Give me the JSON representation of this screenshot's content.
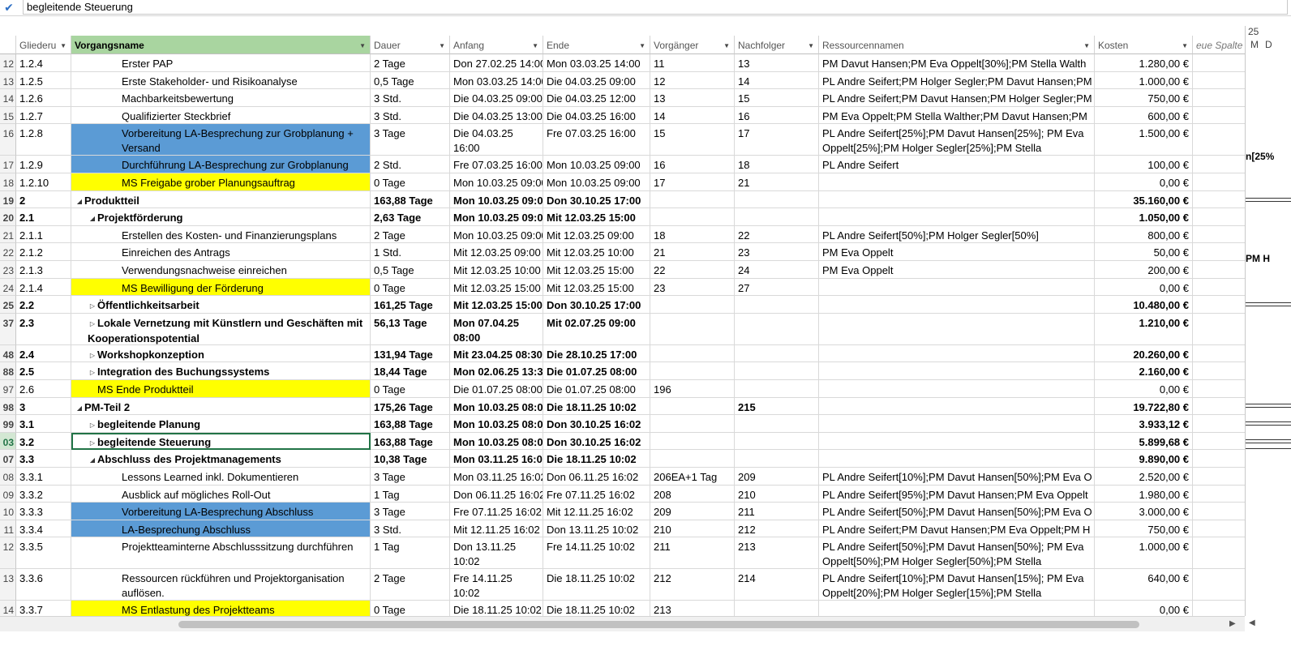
{
  "entry_bar": {
    "value": "begleitende Steuerung"
  },
  "columns": [
    {
      "key": "gliederung",
      "label": "Gliederu"
    },
    {
      "key": "name",
      "label": "Vorgangsname"
    },
    {
      "key": "dauer",
      "label": "Dauer"
    },
    {
      "key": "anfang",
      "label": "Anfang"
    },
    {
      "key": "ende",
      "label": "Ende"
    },
    {
      "key": "vorg",
      "label": "Vorgänger"
    },
    {
      "key": "nachf",
      "label": "Nachfolger"
    },
    {
      "key": "res",
      "label": "Ressourcennamen"
    },
    {
      "key": "kosten",
      "label": "Kosten"
    },
    {
      "key": "neu",
      "label": "eue Spalte h"
    }
  ],
  "gantt": {
    "top_label": "25",
    "day_labels": [
      "M",
      "D"
    ],
    "texts": [
      "n[25%",
      "PM H"
    ]
  },
  "rows": [
    {
      "id": "12",
      "gl": "1.2.4",
      "name": "Erster PAP",
      "level": 3,
      "dauer": "2 Tage",
      "anfang": "Don 27.02.25 14:00",
      "ende": "Mon 03.03.25 14:00",
      "vorg": "11",
      "nachf": "13",
      "res": "PM Davut Hansen;PM Eva Oppelt[30%];PM Stella Walth",
      "kosten": "1.280,00 €"
    },
    {
      "id": "13",
      "gl": "1.2.5",
      "name": "Erste Stakeholder- und Risikoanalyse",
      "level": 3,
      "dauer": "0,5 Tage",
      "anfang": "Mon 03.03.25 14:00",
      "ende": "Die 04.03.25 09:00",
      "vorg": "12",
      "nachf": "14",
      "res": "PL Andre Seifert;PM Holger Segler;PM Davut Hansen;PM",
      "kosten": "1.000,00 €"
    },
    {
      "id": "14",
      "gl": "1.2.6",
      "name": "Machbarkeitsbewertung",
      "level": 3,
      "dauer": "3 Std.",
      "anfang": "Die 04.03.25 09:00",
      "ende": "Die 04.03.25 12:00",
      "vorg": "13",
      "nachf": "15",
      "res": "PL Andre Seifert;PM Davut Hansen;PM Holger Segler;PM",
      "kosten": "750,00 €"
    },
    {
      "id": "15",
      "gl": "1.2.7",
      "name": "Qualifizierter Steckbrief",
      "level": 3,
      "dauer": "3 Std.",
      "anfang": "Die 04.03.25 13:00",
      "ende": "Die 04.03.25 16:00",
      "vorg": "14",
      "nachf": "16",
      "res": "PM Eva Oppelt;PM Stella Walther;PM Davut Hansen;PM",
      "kosten": "600,00 €"
    },
    {
      "id": "16",
      "gl": "1.2.8",
      "name": "Vorbereitung LA-Besprechung zur Grobplanung + Versand",
      "level": 3,
      "hl": "blue",
      "dauer": "3 Tage",
      "anfang": "Die 04.03.25 16:00",
      "ende": "Fre 07.03.25 16:00",
      "vorg": "15",
      "nachf": "17",
      "res": "PL Andre Seifert[25%];PM Davut Hansen[25%]; PM Eva Oppelt[25%];PM Holger Segler[25%];PM Stella",
      "kosten": "1.500,00 €",
      "tall": true
    },
    {
      "id": "17",
      "gl": "1.2.9",
      "name": "Durchführung LA-Besprechung zur Grobplanung",
      "level": 3,
      "hl": "blue",
      "dauer": "2 Std.",
      "anfang": "Fre 07.03.25 16:00",
      "ende": "Mon 10.03.25 09:00",
      "vorg": "16",
      "nachf": "18",
      "res": "PL Andre Seifert",
      "kosten": "100,00 €"
    },
    {
      "id": "18",
      "gl": "1.2.10",
      "name": "MS Freigabe grober Planungsauftrag",
      "level": 3,
      "hl": "yellow",
      "dauer": "0 Tage",
      "anfang": "Mon 10.03.25 09:00",
      "ende": "Mon 10.03.25 09:00",
      "vorg": "17",
      "nachf": "21",
      "res": "",
      "kosten": "0,00 €"
    },
    {
      "id": "19",
      "gl": "2",
      "name": "Produktteil",
      "level": 1,
      "summary": "open",
      "bold": true,
      "dauer": "163,88 Tage",
      "anfang": "Mon 10.03.25 09:00",
      "ende": "Don 30.10.25 17:00",
      "vorg": "",
      "nachf": "",
      "res": "",
      "kosten": "35.160,00 €"
    },
    {
      "id": "20",
      "gl": "2.1",
      "name": "Projektförderung",
      "level": 2,
      "summary": "open",
      "bold": true,
      "dauer": "2,63 Tage",
      "anfang": "Mon 10.03.25 09:00",
      "ende": "Mit 12.03.25 15:00",
      "vorg": "",
      "nachf": "",
      "res": "",
      "kosten": "1.050,00 €"
    },
    {
      "id": "21",
      "gl": "2.1.1",
      "name": "Erstellen des Kosten- und Finanzierungsplans",
      "level": 3,
      "dauer": "2 Tage",
      "anfang": "Mon 10.03.25 09:00",
      "ende": "Mit 12.03.25 09:00",
      "vorg": "18",
      "nachf": "22",
      "res": "PL Andre Seifert[50%];PM Holger Segler[50%]",
      "kosten": "800,00 €"
    },
    {
      "id": "22",
      "gl": "2.1.2",
      "name": "Einreichen des Antrags",
      "level": 3,
      "dauer": "1 Std.",
      "anfang": "Mit 12.03.25 09:00",
      "ende": "Mit 12.03.25 10:00",
      "vorg": "21",
      "nachf": "23",
      "res": "PM Eva Oppelt",
      "kosten": "50,00 €"
    },
    {
      "id": "23",
      "gl": "2.1.3",
      "name": "Verwendungsnachweise einreichen",
      "level": 3,
      "dauer": "0,5 Tage",
      "anfang": "Mit 12.03.25 10:00",
      "ende": "Mit 12.03.25 15:00",
      "vorg": "22",
      "nachf": "24",
      "res": "PM Eva Oppelt",
      "kosten": "200,00 €"
    },
    {
      "id": "24",
      "gl": "2.1.4",
      "name": "MS Bewilligung der Förderung",
      "level": 3,
      "hl": "yellow",
      "dauer": "0 Tage",
      "anfang": "Mit 12.03.25 15:00",
      "ende": "Mit 12.03.25 15:00",
      "vorg": "23",
      "nachf": "27",
      "res": "",
      "kosten": "0,00 €"
    },
    {
      "id": "25",
      "gl": "2.2",
      "name": "Öffentlichkeitsarbeit",
      "level": 2,
      "summary": "closed",
      "bold": true,
      "dauer": "161,25 Tage",
      "anfang": "Mit 12.03.25 15:00",
      "ende": "Don 30.10.25 17:00",
      "vorg": "",
      "nachf": "",
      "res": "",
      "kosten": "10.480,00 €"
    },
    {
      "id": "37",
      "gl": "2.3",
      "name": "Lokale Vernetzung mit Künstlern und Geschäften mit Kooperationspotential",
      "level": 2,
      "summary": "closed",
      "bold": true,
      "dauer": "56,13 Tage",
      "anfang": "Mon 07.04.25 08:00",
      "ende": "Mit 02.07.25 09:00",
      "vorg": "",
      "nachf": "",
      "res": "",
      "kosten": "1.210,00 €",
      "tall": true
    },
    {
      "id": "48",
      "gl": "2.4",
      "name": "Workshopkonzeption",
      "level": 2,
      "summary": "closed",
      "bold": true,
      "dauer": "131,94 Tage",
      "anfang": "Mit 23.04.25 08:30",
      "ende": "Die 28.10.25 17:00",
      "vorg": "",
      "nachf": "",
      "res": "",
      "kosten": "20.260,00 €"
    },
    {
      "id": "88",
      "gl": "2.5",
      "name": "Integration des Buchungssystems",
      "level": 2,
      "summary": "closed",
      "bold": true,
      "dauer": "18,44 Tage",
      "anfang": "Mon 02.06.25 13:30",
      "ende": "Die 01.07.25 08:00",
      "vorg": "",
      "nachf": "",
      "res": "",
      "kosten": "2.160,00 €"
    },
    {
      "id": "97",
      "gl": "2.6",
      "name": "MS Ende Produktteil",
      "level": 2,
      "hl": "yellow",
      "dauer": "0 Tage",
      "anfang": "Die 01.07.25 08:00",
      "ende": "Die 01.07.25 08:00",
      "vorg": "196",
      "nachf": "",
      "res": "",
      "kosten": "0,00 €"
    },
    {
      "id": "98",
      "gl": "3",
      "name": "PM-Teil 2",
      "level": 1,
      "summary": "open",
      "bold": true,
      "dauer": "175,26 Tage",
      "anfang": "Mon 10.03.25 08:00",
      "ende": "Die 18.11.25 10:02",
      "vorg": "",
      "nachf": "215",
      "res": "",
      "kosten": "19.722,80 €"
    },
    {
      "id": "99",
      "gl": "3.1",
      "name": "begleitende Planung",
      "level": 2,
      "summary": "closed",
      "bold": true,
      "dauer": "163,88 Tage",
      "anfang": "Mon 10.03.25 08:00",
      "ende": "Don 30.10.25 16:02",
      "vorg": "",
      "nachf": "",
      "res": "",
      "kosten": "3.933,12 €"
    },
    {
      "id": "03",
      "gl": "3.2",
      "name": "begleitende Steuerung",
      "level": 2,
      "summary": "closed",
      "bold": true,
      "selected": true,
      "dauer": "163,88 Tage",
      "anfang": "Mon 10.03.25 08:00",
      "ende": "Don 30.10.25 16:02",
      "vorg": "",
      "nachf": "",
      "res": "",
      "kosten": "5.899,68 €"
    },
    {
      "id": "07",
      "gl": "3.3",
      "name": "Abschluss des Projektmanagements",
      "level": 2,
      "summary": "open",
      "bold": true,
      "dauer": "10,38 Tage",
      "anfang": "Mon 03.11.25 16:02",
      "ende": "Die 18.11.25 10:02",
      "vorg": "",
      "nachf": "",
      "res": "",
      "kosten": "9.890,00 €"
    },
    {
      "id": "08",
      "gl": "3.3.1",
      "name": "Lessons Learned inkl. Dokumentieren",
      "level": 3,
      "dauer": "3 Tage",
      "anfang": "Mon 03.11.25 16:02",
      "ende": "Don 06.11.25 16:02",
      "vorg": "206EA+1 Tag",
      "nachf": "209",
      "res": "PL Andre Seifert[10%];PM Davut Hansen[50%];PM Eva O",
      "kosten": "2.520,00 €"
    },
    {
      "id": "09",
      "gl": "3.3.2",
      "name": "Ausblick auf mögliches Roll-Out",
      "level": 3,
      "dauer": "1 Tag",
      "anfang": "Don 06.11.25 16:02",
      "ende": "Fre 07.11.25 16:02",
      "vorg": "208",
      "nachf": "210",
      "res": "PL Andre Seifert[95%];PM Davut Hansen;PM Eva Oppelt",
      "kosten": "1.980,00 €"
    },
    {
      "id": "10",
      "gl": "3.3.3",
      "name": "Vorbereitung LA-Besprechung Abschluss",
      "level": 3,
      "hl": "blue",
      "dauer": "3 Tage",
      "anfang": "Fre 07.11.25 16:02",
      "ende": "Mit 12.11.25 16:02",
      "vorg": "209",
      "nachf": "211",
      "res": "PL Andre Seifert[50%];PM Davut Hansen[50%];PM Eva O",
      "kosten": "3.000,00 €"
    },
    {
      "id": "11",
      "gl": "3.3.4",
      "name": "LA-Besprechung Abschluss",
      "level": 3,
      "hl": "blue",
      "dauer": "3 Std.",
      "anfang": "Mit 12.11.25 16:02",
      "ende": "Don 13.11.25 10:02",
      "vorg": "210",
      "nachf": "212",
      "res": "PL Andre Seifert;PM Davut Hansen;PM Eva Oppelt;PM H",
      "kosten": "750,00 €"
    },
    {
      "id": "12",
      "gl": "3.3.5",
      "name": "Projektteaminterne Abschlusssitzung durchführen",
      "level": 3,
      "dauer": "1 Tag",
      "anfang": "Don 13.11.25 10:02",
      "ende": "Fre 14.11.25 10:02",
      "vorg": "211",
      "nachf": "213",
      "res": "PL Andre Seifert[50%];PM Davut Hansen[50%]; PM Eva Oppelt[50%];PM Holger Segler[50%];PM Stella",
      "kosten": "1.000,00 €",
      "tall": true
    },
    {
      "id": "13",
      "gl": "3.3.6",
      "name": "Ressourcen rückführen und Projektorganisation auflösen.",
      "level": 3,
      "dauer": "2 Tage",
      "anfang": "Fre 14.11.25 10:02",
      "ende": "Die 18.11.25 10:02",
      "vorg": "212",
      "nachf": "214",
      "res": "PL Andre Seifert[10%];PM Davut Hansen[15%]; PM Eva Oppelt[20%];PM Holger Segler[15%];PM Stella",
      "kosten": "640,00 €",
      "tall": true
    },
    {
      "id": "14",
      "gl": "3.3.7",
      "name": "MS Entlastung des Projektteams",
      "level": 3,
      "hl": "yellow",
      "dauer": "0 Tage",
      "anfang": "Die 18.11.25 10:02",
      "ende": "Die 18.11.25 10:02",
      "vorg": "213",
      "nachf": "",
      "res": "",
      "kosten": "0,00 €"
    }
  ]
}
